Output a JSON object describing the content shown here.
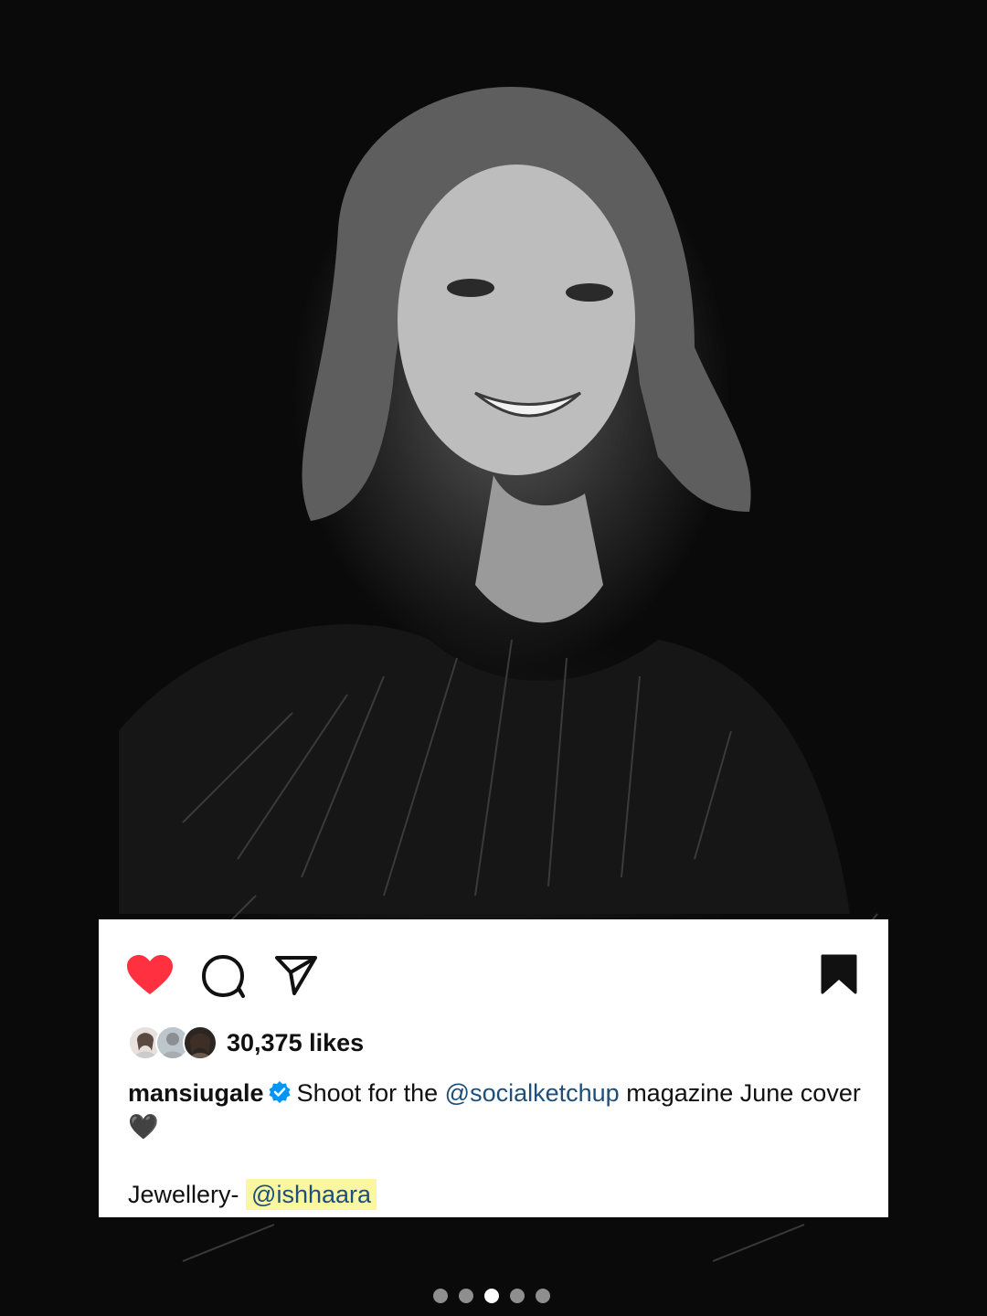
{
  "post": {
    "liked": true,
    "saved": true,
    "likes_text": "30,375 likes",
    "username": "mansiugale",
    "caption_part1": "Shoot for the ",
    "mention_1": "@socialketchup",
    "caption_part2": " magazine June cover 🖤",
    "caption_line2": "Jewellery- ",
    "mention_2": "@ishhaara",
    "like_avatars": 3
  },
  "carousel": {
    "total": 5,
    "active_index": 2
  },
  "icons": [
    "heart-icon",
    "comment-icon",
    "share-icon",
    "bookmark-icon",
    "verified-badge-icon"
  ],
  "colors": {
    "like_red": "#ff3040",
    "mention_blue": "#1d4f7a",
    "highlight_yellow": "#fbf7a0",
    "verified_blue": "#0095f6"
  }
}
